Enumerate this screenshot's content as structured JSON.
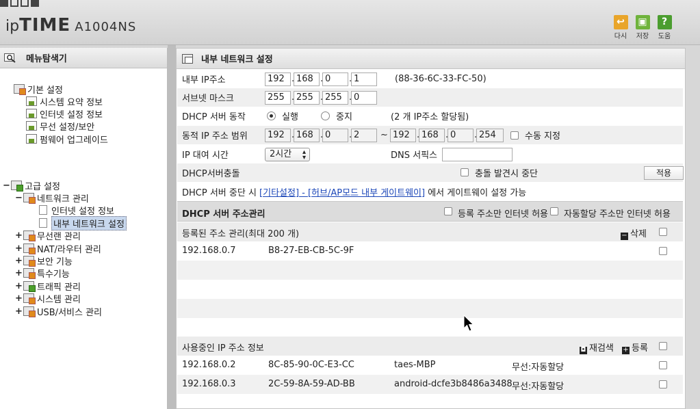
{
  "header": {
    "logo_ip": "ip",
    "logo_time": "TIME",
    "model": "A1004NS",
    "buttons": [
      {
        "label": "다시",
        "icon": "undo-icon"
      },
      {
        "label": "저장",
        "icon": "save-icon"
      },
      {
        "label": "도움",
        "icon": "help-icon",
        "glyph": "?"
      }
    ]
  },
  "sidebar": {
    "title": "메뉴탐색기",
    "basic": {
      "label": "기본 설정",
      "items": [
        "시스템 요약 정보",
        "인터넷 설정 정보",
        "무선 설정/보안",
        "펌웨어 업그레이드"
      ]
    },
    "advanced": {
      "label": "고급 설정",
      "network": {
        "label": "네트워크 관리",
        "items": [
          "인터넷 설정 정보",
          "내부 네트워크 설정"
        ]
      },
      "items": [
        "무선랜 관리",
        "NAT/라우터 관리",
        "보안 기능",
        "특수기능",
        "트래픽 관리",
        "시스템 관리",
        "USB/서비스 관리"
      ]
    },
    "toggles": {
      "minus": "−",
      "plus": "+"
    }
  },
  "main": {
    "title": "내부 네트워크 설정",
    "internal_ip": {
      "label": "내부 IP주소",
      "octets": [
        "192",
        "168",
        "0",
        "1"
      ],
      "mac": "(88-36-6C-33-FC-50)"
    },
    "subnet": {
      "label": "서브넷 마스크",
      "octets": [
        "255",
        "255",
        "255",
        "0"
      ]
    },
    "dhcp": {
      "label": "DHCP 서버 동작",
      "run": "실행",
      "stop": "중지",
      "assigned": "(2 개 IP주소 할당됨)"
    },
    "range": {
      "label": "동적 IP 주소 범위",
      "start": [
        "192",
        "168",
        "0",
        "2"
      ],
      "tilde": "~",
      "end": [
        "192",
        "168",
        "0",
        "254"
      ],
      "manual": "수동 지정"
    },
    "lease": {
      "label": "IP 대여 시간",
      "value": "2시간",
      "dns_label": "DNS 서픽스",
      "dns_value": ""
    },
    "conflict": {
      "label": "DHCP서버충돌",
      "option": "충돌 발견시 중단",
      "apply": "적용"
    },
    "dhcp_note": {
      "prefix": "DHCP 서버 중단 시 ",
      "link": "[기타설정] - [허브/AP모드 내부 게이트웨이]",
      "suffix": " 에서 게이트웨이 설정 가능"
    },
    "addr_mgmt": {
      "title": "DHCP 서버 주소관리",
      "opt1": "등록 주소만 인터넷 허용",
      "opt2": "자동할당 주소만 인터넷 허용"
    },
    "registered": {
      "header": "등록된 주소 관리(최대 200 개)",
      "delete": "삭제",
      "rows": [
        {
          "ip": "192.168.0.7",
          "mac": "B8-27-EB-CB-5C-9F"
        }
      ]
    },
    "in_use": {
      "header": "사용중인 IP 주소 정보",
      "rescan": "재검색",
      "register": "등록",
      "rows": [
        {
          "ip": "192.168.0.2",
          "mac": "8C-85-90-0C-E3-CC",
          "host": "taes-MBP",
          "type": "무선:자동할당"
        },
        {
          "ip": "192.168.0.3",
          "mac": "2C-59-8A-59-AD-BB",
          "host": "android-dcfe3b8486a3488",
          "type": "무선:자동할당"
        }
      ]
    }
  }
}
